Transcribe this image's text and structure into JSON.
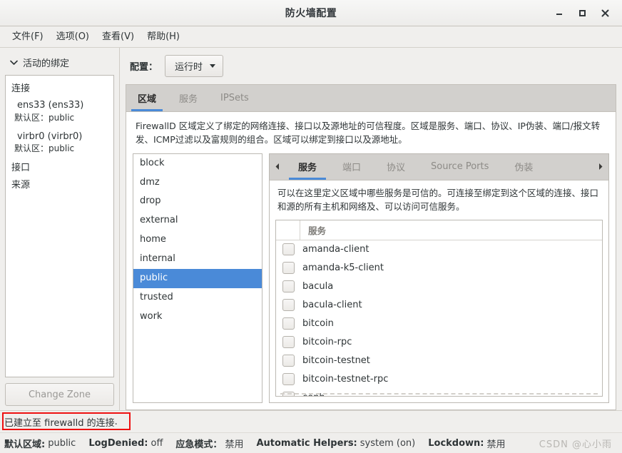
{
  "window": {
    "title": "防火墙配置",
    "buttons": {
      "minimize": "minimize-icon",
      "maximize": "maximize-icon",
      "close": "close-icon"
    }
  },
  "menubar": {
    "items": [
      {
        "label": "文件(F)"
      },
      {
        "label": "选项(O)"
      },
      {
        "label": "查看(V)"
      },
      {
        "label": "帮助(H)"
      }
    ]
  },
  "left_panel": {
    "expander_label": "活动的绑定",
    "groups": [
      {
        "title": "连接"
      },
      {
        "title": "接口"
      },
      {
        "title": "来源"
      }
    ],
    "connections": [
      {
        "name": "ens33 (ens33)",
        "zone_key": "默认区",
        "zone_sep": "：",
        "zone_value": "public"
      },
      {
        "name": "virbr0 (virbr0)",
        "zone_key": "默认区",
        "zone_sep": "：",
        "zone_value": "public"
      }
    ],
    "change_zone_label": "Change Zone"
  },
  "config_bar": {
    "label": "配置：",
    "selected": "运行时"
  },
  "main_tabs": [
    {
      "label": "区域",
      "active": true
    },
    {
      "label": "服务",
      "active": false
    },
    {
      "label": "IPSets",
      "active": false
    }
  ],
  "zone_description": "FirewallD 区域定义了绑定的网络连接、接口以及源地址的可信程度。区域是服务、端口、协议、IP伪装、端口/报文转发、ICMP过滤以及富规则的组合。区域可以绑定到接口以及源地址。",
  "zones": [
    {
      "name": "block",
      "selected": false
    },
    {
      "name": "dmz",
      "selected": false
    },
    {
      "name": "drop",
      "selected": false
    },
    {
      "name": "external",
      "selected": false
    },
    {
      "name": "home",
      "selected": false
    },
    {
      "name": "internal",
      "selected": false
    },
    {
      "name": "public",
      "selected": true
    },
    {
      "name": "trusted",
      "selected": false
    },
    {
      "name": "work",
      "selected": false
    }
  ],
  "inner_tabs": [
    {
      "label": "服务",
      "active": true
    },
    {
      "label": "端口",
      "active": false
    },
    {
      "label": "协议",
      "active": false
    },
    {
      "label": "Source Ports",
      "active": false
    },
    {
      "label": "伪装",
      "active": false
    }
  ],
  "service_description": "可以在这里定义区域中哪些服务是可信的。可连接至绑定到这个区域的连接、接口和源的所有主机和网络及、可以访问可信服务。",
  "service_table": {
    "column_header": "服务",
    "rows": [
      {
        "name": "amanda-client",
        "checked": false
      },
      {
        "name": "amanda-k5-client",
        "checked": false
      },
      {
        "name": "bacula",
        "checked": false
      },
      {
        "name": "bacula-client",
        "checked": false
      },
      {
        "name": "bitcoin",
        "checked": false
      },
      {
        "name": "bitcoin-rpc",
        "checked": false
      },
      {
        "name": "bitcoin-testnet",
        "checked": false
      },
      {
        "name": "bitcoin-testnet-rpc",
        "checked": false
      },
      {
        "name": "ceph",
        "checked": false
      }
    ]
  },
  "status": {
    "connected_text": "已建立至 firewalld 的连接",
    "connected_period": ".",
    "highlight_color": "#ee1111",
    "items": [
      {
        "key": "默认区域:",
        "value": "public"
      },
      {
        "key": "LogDenied:",
        "value": "off"
      },
      {
        "key": "应急模式：",
        "value": "禁用"
      },
      {
        "key": "Automatic Helpers:",
        "value": "system (on)"
      },
      {
        "key": "Lockdown:",
        "value": "禁用"
      }
    ]
  },
  "watermark": "CSDN @心小雨",
  "colors": {
    "selection": "#4a8ad8",
    "tab_underline": "#4a8ad8",
    "window_bg": "#f0efed",
    "tabstrip_bg": "#d2d0cd"
  }
}
